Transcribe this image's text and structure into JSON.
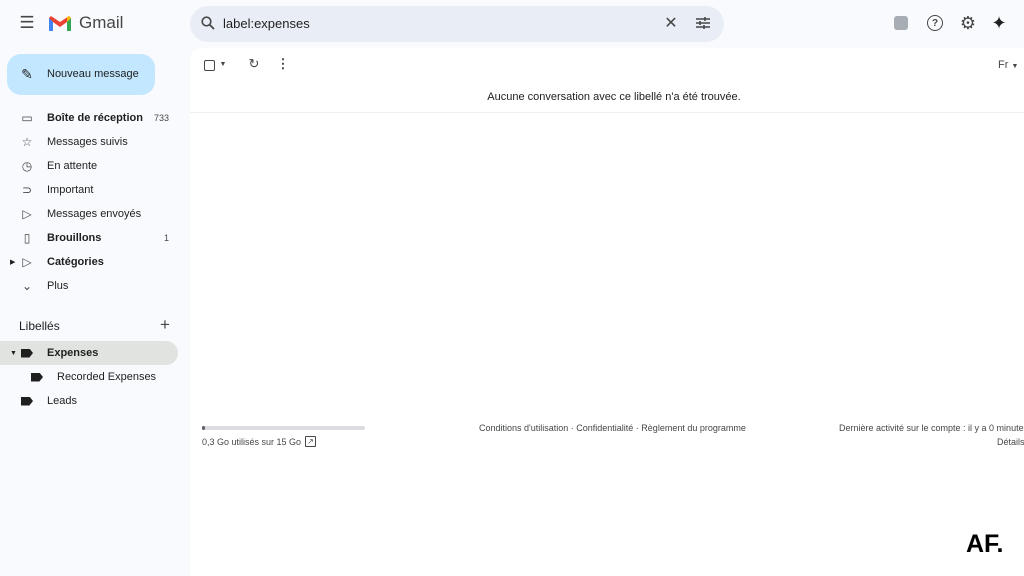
{
  "header": {
    "app_name": "Gmail",
    "search_value": "label:expenses"
  },
  "compose_label": "Nouveau message",
  "sidebar": {
    "items": [
      {
        "label": "Boîte de réception",
        "count": "733",
        "bold": true,
        "icon": "inbox-icon"
      },
      {
        "label": "Messages suivis",
        "count": "",
        "icon": "star-icon"
      },
      {
        "label": "En attente",
        "count": "",
        "icon": "clock-icon"
      },
      {
        "label": "Important",
        "count": "",
        "icon": "important-icon"
      },
      {
        "label": "Messages envoyés",
        "count": "",
        "icon": "send-icon"
      },
      {
        "label": "Brouillons",
        "count": "1",
        "bold": true,
        "icon": "draft-icon"
      },
      {
        "label": "Catégories",
        "count": "",
        "bold": true,
        "icon": "label-icon"
      },
      {
        "label": "Plus",
        "count": "",
        "icon": "chevron-down-icon"
      }
    ],
    "labels_title": "Libellés",
    "labels": [
      {
        "label": "Expenses",
        "active": true
      },
      {
        "label": "Recorded Expenses"
      },
      {
        "label": "Leads"
      }
    ]
  },
  "toolbar": {
    "input_tools": "Fr"
  },
  "main": {
    "empty_message": "Aucune conversation avec ce libellé n'a été trouvée."
  },
  "footer": {
    "storage": "0,3 Go utilisés sur 15 Go",
    "storage_fraction": 0.02,
    "links": "Conditions d'utilisation · Confidentialité · Règlement du programme",
    "last_activity": "Dernière activité sur le compte : il y a 0 minute",
    "details": "Détails"
  },
  "watermark": "AF."
}
